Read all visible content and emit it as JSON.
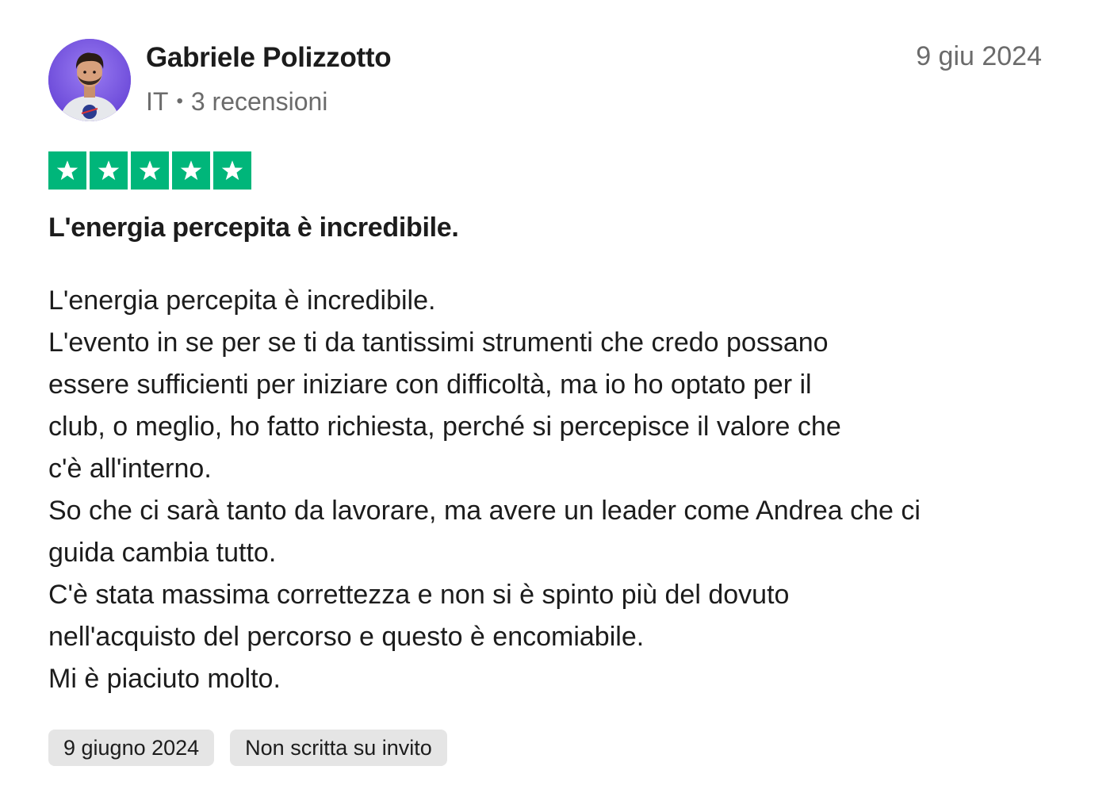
{
  "reviewer": {
    "name": "Gabriele Polizzotto",
    "country": "IT",
    "separator": "•",
    "reviews_count": "3 recensioni",
    "avatar_icon": "user-photo-avatar"
  },
  "review": {
    "date_short": "9 giu 2024",
    "rating": 5,
    "rating_max": 5,
    "star_color": "#00b67a",
    "title": "L'energia percepita è incredibile.",
    "body_lines": [
      "L'energia percepita è incredibile.",
      "L'evento in se per se ti da tantissimi strumenti che credo possano",
      "essere sufficienti per iniziare con difficoltà, ma io ho optato per il",
      "club, o meglio, ho fatto richiesta, perché si percepisce il valore che",
      "c'è all'interno.",
      "So che ci sarà tanto da lavorare, ma avere un leader come Andrea che ci",
      "guida cambia tutto.",
      "C'è stata massima correttezza e non si è spinto più del dovuto",
      "nell'acquisto del percorso e questo è encomiabile.",
      "Mi è piaciuto molto."
    ],
    "tags": [
      "9 giugno 2024",
      "Non scritta su invito"
    ]
  }
}
